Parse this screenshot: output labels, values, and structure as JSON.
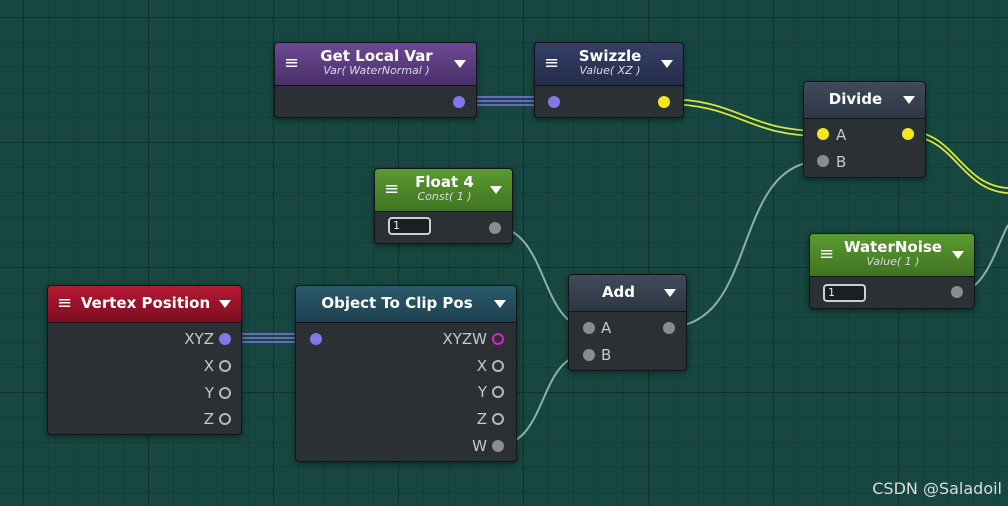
{
  "nodes": {
    "get_local_var": {
      "title": "Get Local Var",
      "subtitle": "Var( WaterNormal )"
    },
    "swizzle": {
      "title": "Swizzle",
      "subtitle": "Value( XZ )"
    },
    "divide": {
      "title": "Divide",
      "inputs": [
        "A",
        "B"
      ]
    },
    "float4": {
      "title": "Float 4",
      "subtitle": "Const( 1 )",
      "value": "1"
    },
    "water_noise": {
      "title": "WaterNoise",
      "subtitle": "Value( 1 )",
      "value": "1"
    },
    "add": {
      "title": "Add",
      "inputs": [
        "A",
        "B"
      ]
    },
    "vertex_position": {
      "title": "Vertex Position",
      "outputs": [
        "XYZ",
        "X",
        "Y",
        "Z"
      ]
    },
    "object_to_clip": {
      "title": "Object To Clip Pos",
      "outputs": [
        "XYZW",
        "X",
        "Y",
        "Z",
        "W"
      ]
    }
  },
  "colors": {
    "canvas": "#174740",
    "wire_vector": "#8277e8",
    "wire_float2": "#f1e71a",
    "wire_float": "#8cb0ac"
  },
  "watermark": "CSDN @Saladoil"
}
